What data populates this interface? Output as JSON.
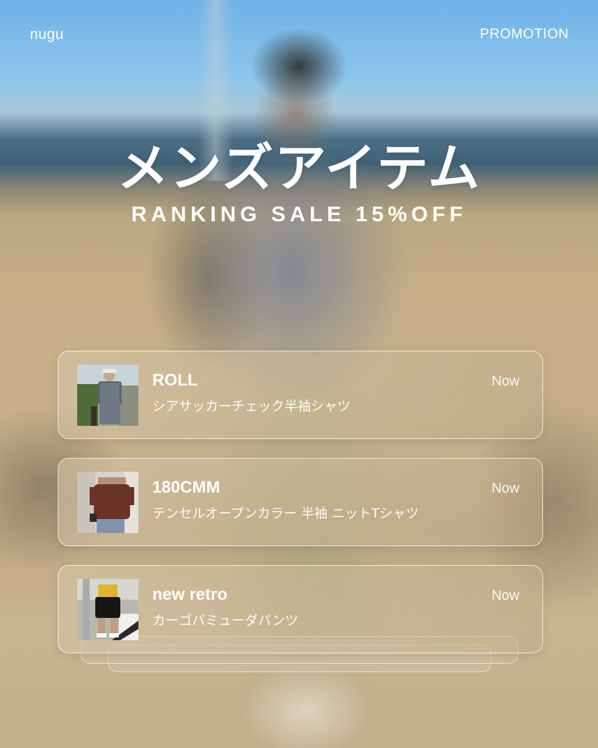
{
  "header": {
    "brand": "nugu",
    "promotion_label": "PROMOTION"
  },
  "hero": {
    "title": "メンズアイテム",
    "subtitle": "RANKING SALE 15%OFF"
  },
  "notifications": [
    {
      "name": "ROLL",
      "product": "シアサッカーチェック半袖シャツ",
      "time": "Now",
      "thumbnail": "man-in-checked-shirt-photo"
    },
    {
      "name": "180CMM",
      "product": "テンセルオープンカラー 半袖 ニットTシャツ",
      "time": "Now",
      "thumbnail": "man-in-brown-knit-shirt-photo"
    },
    {
      "name": "new retro",
      "product": "カーゴバミューダパンツ",
      "time": "Now",
      "thumbnail": "man-in-cargo-shorts-photo"
    }
  ]
}
